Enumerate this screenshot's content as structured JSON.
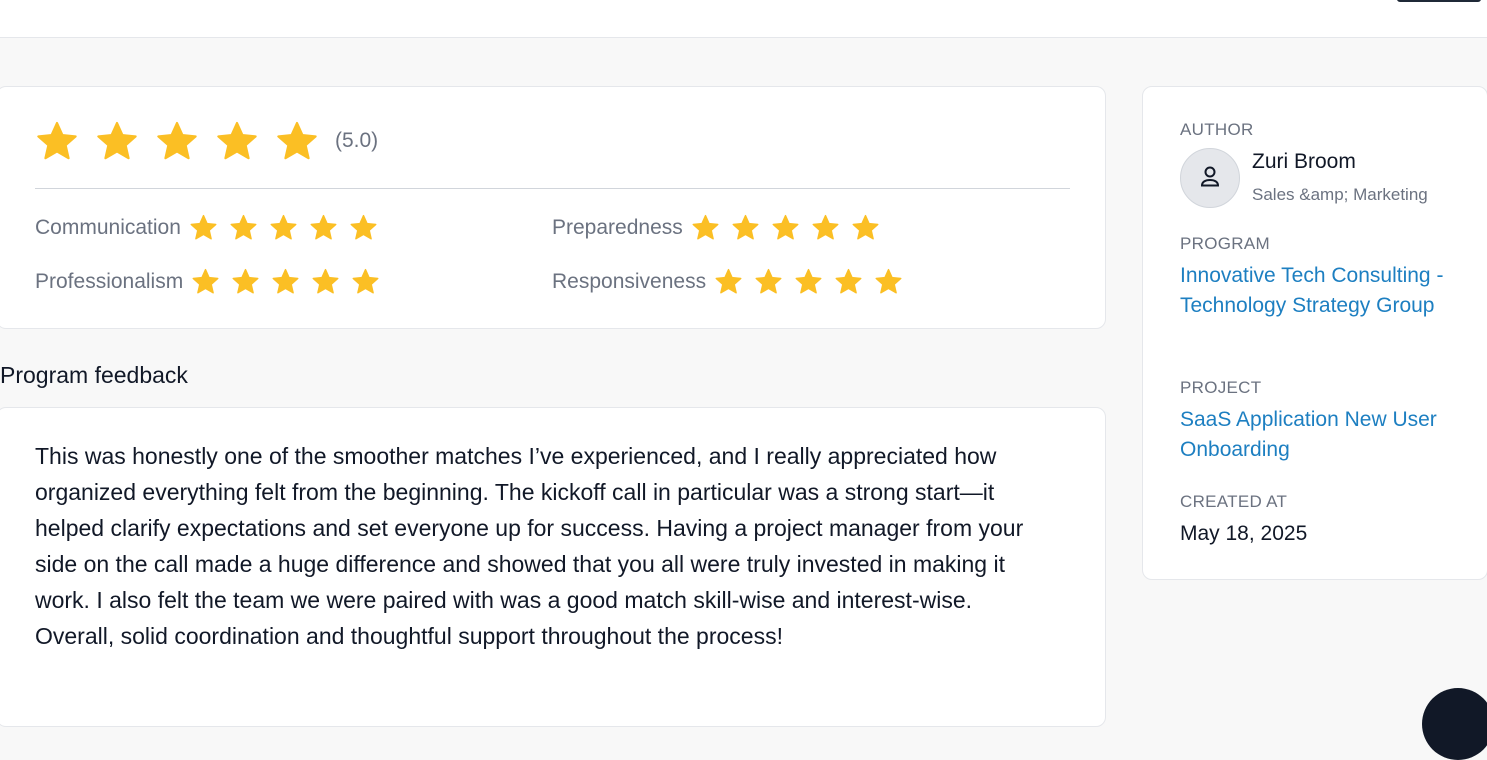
{
  "colors": {
    "star": "#fbbf24",
    "link": "#1d7fc1",
    "muted_text": "#6b7280"
  },
  "overall_rating": {
    "stars": 5,
    "score_text": "(5.0)"
  },
  "categories": [
    {
      "label": "Communication",
      "stars": 5
    },
    {
      "label": "Preparedness",
      "stars": 5
    },
    {
      "label": "Professionalism",
      "stars": 5
    },
    {
      "label": "Responsiveness",
      "stars": 5
    }
  ],
  "feedback": {
    "title": "Program feedback",
    "text": "This was honestly one of the smoother matches I’ve experienced, and I really appreciated how organized everything felt from the beginning. The kickoff call in particular was a strong start—it helped clarify expectations and set everyone up for success. Having a project manager from your side on the call made a huge difference and showed that you all were truly invested in making it work. I also felt the team we were paired with was a good match skill-wise and interest-wise. Overall, solid coordination and thoughtful support throughout the process!"
  },
  "sidebar": {
    "author_label": "AUTHOR",
    "author_name": "Zuri Broom",
    "author_role": "Sales &amp; Marketing",
    "author_avatar_icon": "user-icon",
    "program_label": "PROGRAM",
    "program_name": "Innovative Tech Consulting - Technology Strategy Group",
    "project_label": "PROJECT",
    "project_name": "SaaS Application New User Onboarding",
    "created_label": "CREATED AT",
    "created_value": "May 18, 2025"
  }
}
